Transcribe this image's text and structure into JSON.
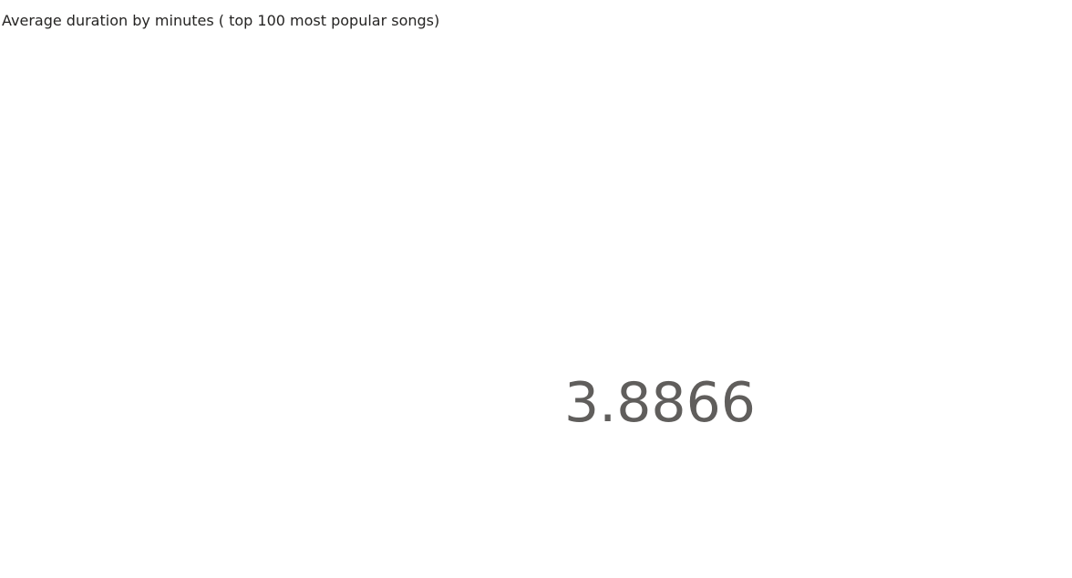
{
  "chart_data": {
    "type": "card",
    "title": "Average duration by minutes ( top 100 most popular songs)",
    "value": "3.8866"
  },
  "colors": {
    "background": "#ffffff",
    "title_text": "#252423",
    "value_text": "#605e5c"
  }
}
